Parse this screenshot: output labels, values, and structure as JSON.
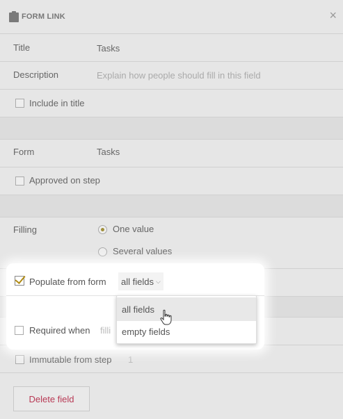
{
  "dialog": {
    "title": "FORM LINK",
    "close_label": "×"
  },
  "fields": {
    "title_label": "Title",
    "title_value": "Tasks",
    "description_label": "Description",
    "description_placeholder": "Explain how people should fill in this field",
    "include_in_title": "Include in title",
    "form_label": "Form",
    "form_value": "Tasks",
    "approved_on_step": "Approved on step",
    "filling_label": "Filling",
    "one_value": "One value",
    "several_values": "Several values",
    "populate_from_form": "Populate from form",
    "populate_selected": "all fields",
    "required_when": "Required when",
    "required_placeholder": "filli",
    "immutable_from_step": "Immutable from step",
    "immutable_value": "1"
  },
  "dropdown": {
    "options": [
      "all fields",
      "empty fields"
    ]
  },
  "actions": {
    "delete_label": "Delete field"
  },
  "icons": {
    "header": "clipboard-icon",
    "close": "close-icon",
    "chevron": "chevron-down-icon",
    "cursor": "hand-pointer-icon"
  },
  "colors": {
    "accent": "#b08a12",
    "delete_text": "#b83a55",
    "radio_dot": "#a08f3a"
  }
}
